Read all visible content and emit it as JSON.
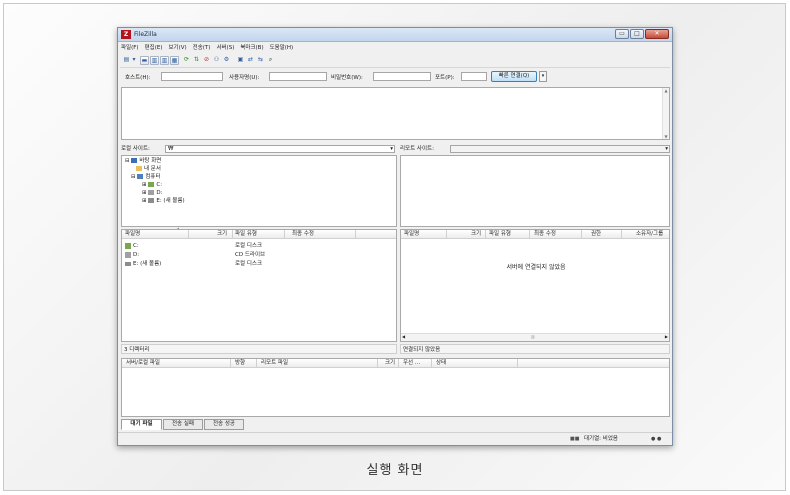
{
  "window": {
    "title": "FileZilla",
    "app_icon": "Z",
    "min": "▭",
    "max": "□",
    "close": "✕"
  },
  "menu": [
    "파일(F)",
    "편집(E)",
    "보기(V)",
    "전송(T)",
    "서버(S)",
    "북마크(B)",
    "도움말(H)"
  ],
  "toolbar": {
    "icons": [
      "site-manager-icon",
      "dropdown-icon",
      "toggle-log-icon",
      "toggle-local-tree-icon",
      "toggle-remote-tree-icon",
      "toggle-queue-icon",
      "refresh-icon",
      "process-queue-icon",
      "cancel-icon",
      "disconnect-icon",
      "reconnect-icon",
      "filter-icon",
      "compare-icon",
      "sync-browse-icon",
      "search-icon"
    ]
  },
  "quickconnect": {
    "host_label": "호스트(H):",
    "user_label": "사용자명(U):",
    "pass_label": "비밀번호(W):",
    "port_label": "포트(P):",
    "button": "빠른 연결(Q)",
    "dropdown": "▾"
  },
  "local": {
    "site_label": "로컬 사이트:",
    "path": "₩",
    "dropdown": "▾",
    "tree": [
      {
        "label": "바탕 화면",
        "expander": "⊟"
      },
      {
        "label": "내 문서",
        "expander": ""
      },
      {
        "label": "컴퓨터",
        "expander": "⊟"
      },
      {
        "label": "C:",
        "expander": "⊞"
      },
      {
        "label": "D:",
        "expander": "⊞"
      },
      {
        "label": "E: (새 볼륨)",
        "expander": "⊞"
      }
    ],
    "columns": [
      "파일명",
      "크기",
      "파일 유형",
      "최종 수정"
    ],
    "sort_arrow": "˄",
    "rows": [
      {
        "name": "C:",
        "type": "로컬 디스크"
      },
      {
        "name": "D:",
        "type": "CD 드라이브"
      },
      {
        "name": "E: (새 볼륨)",
        "type": "로컬 디스크"
      }
    ],
    "status": "3 디렉터리"
  },
  "remote": {
    "site_label": "리모트 사이트:",
    "dropdown": "▾",
    "columns": [
      "파일명",
      "크기",
      "파일 유형",
      "최종 수정",
      "권한",
      "소유자/그룹"
    ],
    "message": "서버에 연결되지 않았음",
    "status": "연결되지 않았음"
  },
  "queue": {
    "columns": [
      "서버/로컬 파일",
      "방향",
      "리모트 파일",
      "크기",
      "우선 ...",
      "상태"
    ],
    "tabs": [
      "대기 파일",
      "전송 실패",
      "전송 성공"
    ],
    "status_text": "대기열: 비었음",
    "status_icon": "■■",
    "status_dots": "● ●"
  },
  "caption": "실행 화면",
  "colors": {
    "accent": "#3c7fb1",
    "brand": "#b3131b",
    "title_bar": "#c3d5ec"
  }
}
